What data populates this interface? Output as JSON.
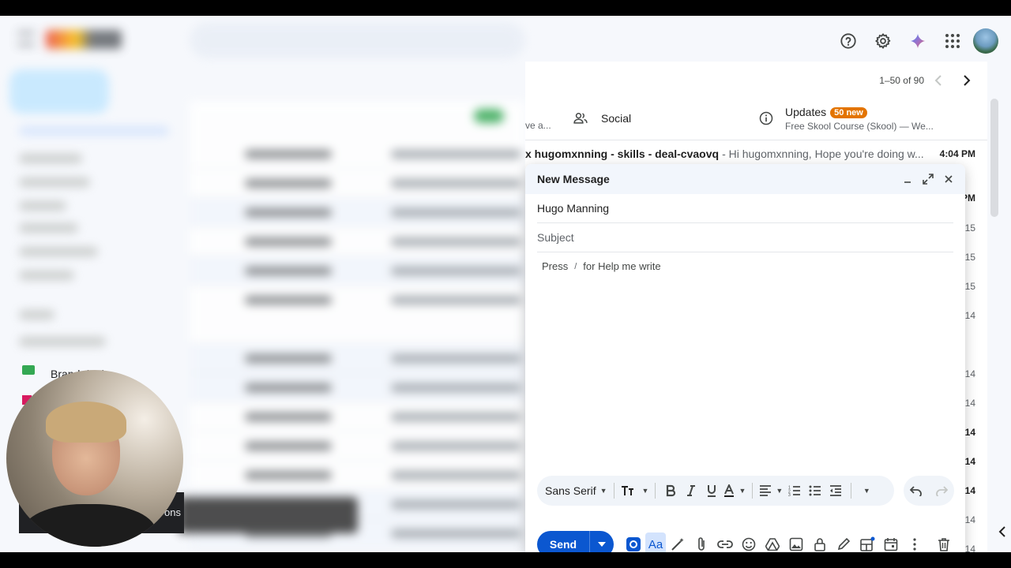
{
  "pager": {
    "text": "1–50 of 90"
  },
  "tabs": {
    "cutoff_snippet": "ve a...",
    "social": "Social",
    "updates": "Updates",
    "updates_badge": "50 new",
    "updates_sub": "Free Skool Course (Skool) — We..."
  },
  "first_row": {
    "subject": "x hugomxnning - skills - deal-cvaovq",
    "snippet": "- Hi hugomxnning, Hope you're doing w...",
    "time": "4:04 PM"
  },
  "background_times": [
    "PM",
    "15",
    "15",
    "15",
    "14",
    "14",
    "14",
    "14",
    "14",
    "14",
    "14",
    "14"
  ],
  "compose": {
    "title": "New Message",
    "to": "Hugo Manning",
    "subject_placeholder": "Subject",
    "hint_press": "Press",
    "hint_key": "/",
    "hint_rest": "for Help me write",
    "font": "Sans Serif",
    "send": "Send"
  },
  "sidebar_label": "Brand deal",
  "cam_caption": "ons",
  "icons": {
    "help": "help-circle-icon",
    "settings": "gear-icon",
    "gemini": "gemini-sparkle-icon",
    "apps": "apps-grid-icon"
  },
  "colors": {
    "accent": "#0b57d0",
    "badge": "#e37400",
    "gemini": "#4285f4"
  }
}
